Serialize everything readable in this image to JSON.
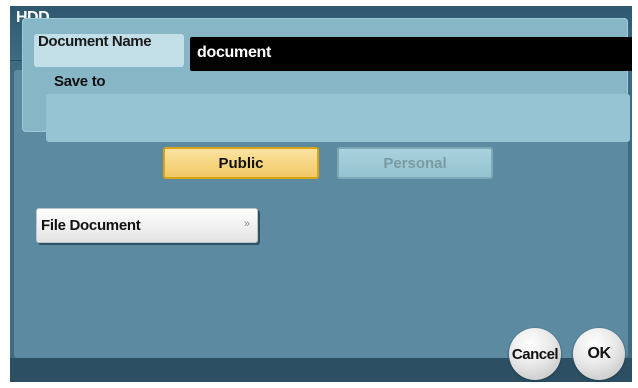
{
  "window": {
    "title": "HDD"
  },
  "document_name": {
    "label": "Document Name",
    "value": "document"
  },
  "save_to": {
    "label": "Save to",
    "options": [
      "Public",
      "Personal"
    ],
    "selected": "Public"
  },
  "file_document_button": {
    "label": "File Document",
    "arrow": "»"
  },
  "footer": {
    "cancel_label": "Cancel",
    "ok_label": "OK"
  },
  "colors": {
    "selected_button": "#f1c865",
    "selected_border": "#d9a412",
    "panel_background": "#87b7c7",
    "screen_background": "#3e6a82"
  }
}
